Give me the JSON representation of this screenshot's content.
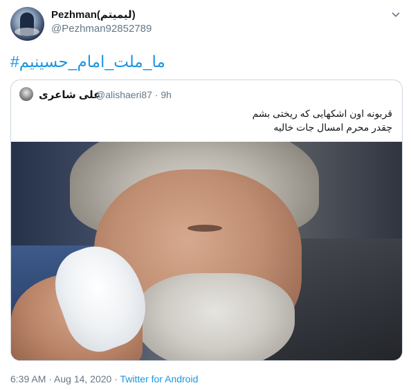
{
  "author": {
    "display_name": "Pezhman(لیمیتم)",
    "handle": "@Pezhman92852789"
  },
  "tweet": {
    "text": "#ما_ملت_امام_حسینیم"
  },
  "quoted": {
    "name": "علی شاعری",
    "handle_time": "@alishaeri87 · 9h",
    "lines": [
      "قربونه اون اشکهایی که ریختی بشم",
      "چقدر محرم امسال جات خالیه"
    ]
  },
  "meta": {
    "timestamp": "6:39 AM · Aug 14, 2020 · ",
    "source": "Twitter for Android"
  },
  "colors": {
    "link": "#1b95e0",
    "secondary": "#657786",
    "border": "#ccd6dd"
  }
}
